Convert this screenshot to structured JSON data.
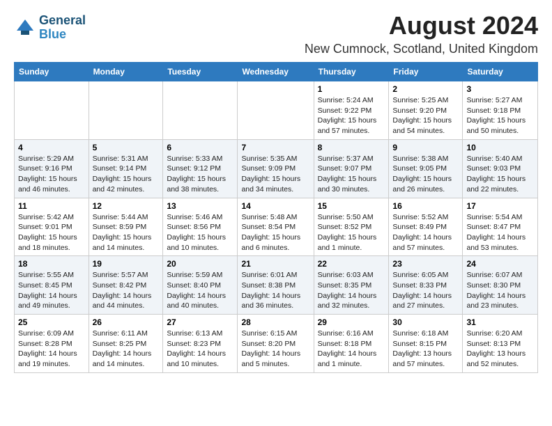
{
  "header": {
    "logo_line1": "General",
    "logo_line2": "Blue",
    "month_year": "August 2024",
    "location": "New Cumnock, Scotland, United Kingdom"
  },
  "weekdays": [
    "Sunday",
    "Monday",
    "Tuesday",
    "Wednesday",
    "Thursday",
    "Friday",
    "Saturday"
  ],
  "weeks": [
    [
      {
        "day": "",
        "info": ""
      },
      {
        "day": "",
        "info": ""
      },
      {
        "day": "",
        "info": ""
      },
      {
        "day": "",
        "info": ""
      },
      {
        "day": "1",
        "info": "Sunrise: 5:24 AM\nSunset: 9:22 PM\nDaylight: 15 hours\nand 57 minutes."
      },
      {
        "day": "2",
        "info": "Sunrise: 5:25 AM\nSunset: 9:20 PM\nDaylight: 15 hours\nand 54 minutes."
      },
      {
        "day": "3",
        "info": "Sunrise: 5:27 AM\nSunset: 9:18 PM\nDaylight: 15 hours\nand 50 minutes."
      }
    ],
    [
      {
        "day": "4",
        "info": "Sunrise: 5:29 AM\nSunset: 9:16 PM\nDaylight: 15 hours\nand 46 minutes."
      },
      {
        "day": "5",
        "info": "Sunrise: 5:31 AM\nSunset: 9:14 PM\nDaylight: 15 hours\nand 42 minutes."
      },
      {
        "day": "6",
        "info": "Sunrise: 5:33 AM\nSunset: 9:12 PM\nDaylight: 15 hours\nand 38 minutes."
      },
      {
        "day": "7",
        "info": "Sunrise: 5:35 AM\nSunset: 9:09 PM\nDaylight: 15 hours\nand 34 minutes."
      },
      {
        "day": "8",
        "info": "Sunrise: 5:37 AM\nSunset: 9:07 PM\nDaylight: 15 hours\nand 30 minutes."
      },
      {
        "day": "9",
        "info": "Sunrise: 5:38 AM\nSunset: 9:05 PM\nDaylight: 15 hours\nand 26 minutes."
      },
      {
        "day": "10",
        "info": "Sunrise: 5:40 AM\nSunset: 9:03 PM\nDaylight: 15 hours\nand 22 minutes."
      }
    ],
    [
      {
        "day": "11",
        "info": "Sunrise: 5:42 AM\nSunset: 9:01 PM\nDaylight: 15 hours\nand 18 minutes."
      },
      {
        "day": "12",
        "info": "Sunrise: 5:44 AM\nSunset: 8:59 PM\nDaylight: 15 hours\nand 14 minutes."
      },
      {
        "day": "13",
        "info": "Sunrise: 5:46 AM\nSunset: 8:56 PM\nDaylight: 15 hours\nand 10 minutes."
      },
      {
        "day": "14",
        "info": "Sunrise: 5:48 AM\nSunset: 8:54 PM\nDaylight: 15 hours\nand 6 minutes."
      },
      {
        "day": "15",
        "info": "Sunrise: 5:50 AM\nSunset: 8:52 PM\nDaylight: 15 hours\nand 1 minute."
      },
      {
        "day": "16",
        "info": "Sunrise: 5:52 AM\nSunset: 8:49 PM\nDaylight: 14 hours\nand 57 minutes."
      },
      {
        "day": "17",
        "info": "Sunrise: 5:54 AM\nSunset: 8:47 PM\nDaylight: 14 hours\nand 53 minutes."
      }
    ],
    [
      {
        "day": "18",
        "info": "Sunrise: 5:55 AM\nSunset: 8:45 PM\nDaylight: 14 hours\nand 49 minutes."
      },
      {
        "day": "19",
        "info": "Sunrise: 5:57 AM\nSunset: 8:42 PM\nDaylight: 14 hours\nand 44 minutes."
      },
      {
        "day": "20",
        "info": "Sunrise: 5:59 AM\nSunset: 8:40 PM\nDaylight: 14 hours\nand 40 minutes."
      },
      {
        "day": "21",
        "info": "Sunrise: 6:01 AM\nSunset: 8:38 PM\nDaylight: 14 hours\nand 36 minutes."
      },
      {
        "day": "22",
        "info": "Sunrise: 6:03 AM\nSunset: 8:35 PM\nDaylight: 14 hours\nand 32 minutes."
      },
      {
        "day": "23",
        "info": "Sunrise: 6:05 AM\nSunset: 8:33 PM\nDaylight: 14 hours\nand 27 minutes."
      },
      {
        "day": "24",
        "info": "Sunrise: 6:07 AM\nSunset: 8:30 PM\nDaylight: 14 hours\nand 23 minutes."
      }
    ],
    [
      {
        "day": "25",
        "info": "Sunrise: 6:09 AM\nSunset: 8:28 PM\nDaylight: 14 hours\nand 19 minutes."
      },
      {
        "day": "26",
        "info": "Sunrise: 6:11 AM\nSunset: 8:25 PM\nDaylight: 14 hours\nand 14 minutes."
      },
      {
        "day": "27",
        "info": "Sunrise: 6:13 AM\nSunset: 8:23 PM\nDaylight: 14 hours\nand 10 minutes."
      },
      {
        "day": "28",
        "info": "Sunrise: 6:15 AM\nSunset: 8:20 PM\nDaylight: 14 hours\nand 5 minutes."
      },
      {
        "day": "29",
        "info": "Sunrise: 6:16 AM\nSunset: 8:18 PM\nDaylight: 14 hours\nand 1 minute."
      },
      {
        "day": "30",
        "info": "Sunrise: 6:18 AM\nSunset: 8:15 PM\nDaylight: 13 hours\nand 57 minutes."
      },
      {
        "day": "31",
        "info": "Sunrise: 6:20 AM\nSunset: 8:13 PM\nDaylight: 13 hours\nand 52 minutes."
      }
    ]
  ]
}
